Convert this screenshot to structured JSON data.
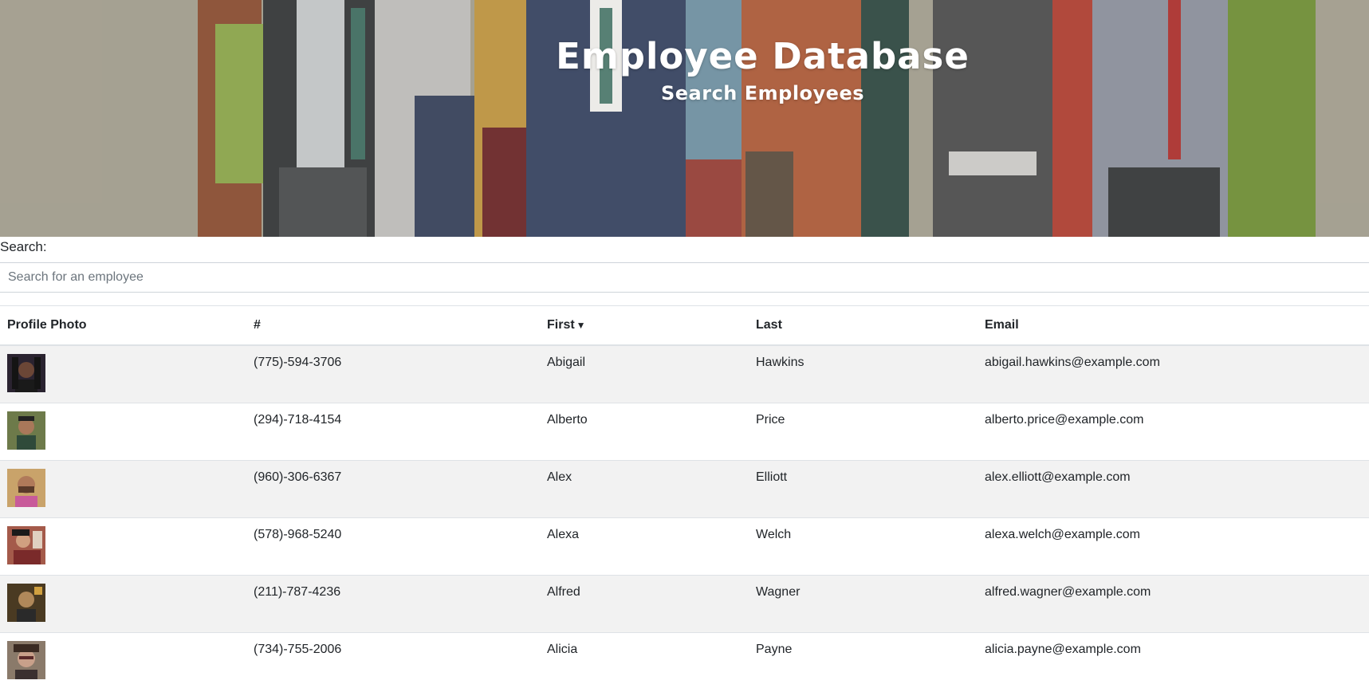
{
  "header": {
    "title": "Employee Database",
    "subtitle": "Search Employees"
  },
  "search": {
    "label": "Search:",
    "placeholder": "Search for an employee",
    "value": ""
  },
  "table": {
    "columns": {
      "photo": "Profile Photo",
      "phone": "#",
      "first": "First",
      "first_sort_indicator": "▼",
      "last": "Last",
      "email": "Email"
    },
    "rows": [
      {
        "phone": "(775)-594-3706",
        "first": "Abigail",
        "last": "Hawkins",
        "email": "abigail.hawkins@example.com"
      },
      {
        "phone": "(294)-718-4154",
        "first": "Alberto",
        "last": "Price",
        "email": "alberto.price@example.com"
      },
      {
        "phone": "(960)-306-6367",
        "first": "Alex",
        "last": "Elliott",
        "email": "alex.elliott@example.com"
      },
      {
        "phone": "(578)-968-5240",
        "first": "Alexa",
        "last": "Welch",
        "email": "alexa.welch@example.com"
      },
      {
        "phone": "(211)-787-4236",
        "first": "Alfred",
        "last": "Wagner",
        "email": "alfred.wagner@example.com"
      },
      {
        "phone": "(734)-755-2006",
        "first": "Alicia",
        "last": "Payne",
        "email": "alicia.payne@example.com"
      }
    ]
  },
  "colors": {
    "hero_background": "#a8a395",
    "row_stripe": "#f2f2f2",
    "border": "#dee2e6"
  }
}
